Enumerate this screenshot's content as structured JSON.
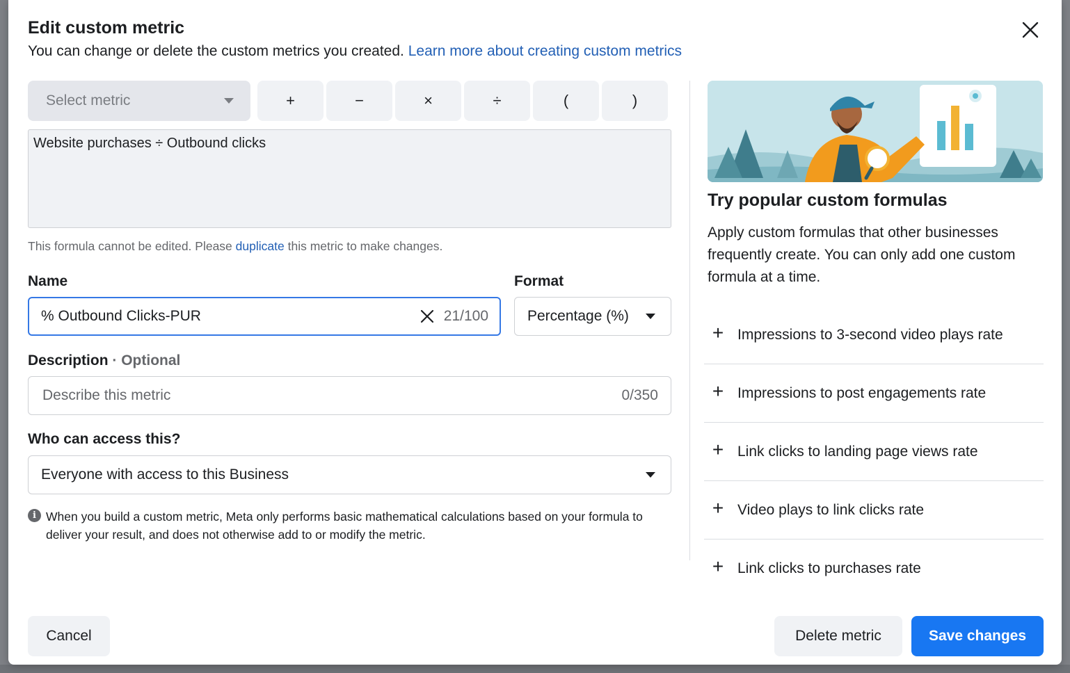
{
  "dialog": {
    "title": "Edit custom metric",
    "subtitle": "You can change or delete the custom metrics you created.",
    "learn_more_link": "Learn more about creating custom metrics"
  },
  "formula_builder": {
    "select_metric_placeholder": "Select metric",
    "operators": [
      "+",
      "−",
      "×",
      "÷",
      "(",
      ")"
    ],
    "formula": "Website purchases ÷ Outbound clicks",
    "note_before": "This formula cannot be edited. Please",
    "note_link": "duplicate",
    "note_after": "this metric to make changes."
  },
  "name_field": {
    "label": "Name",
    "value": "% Outbound Clicks-PUR",
    "count": "21/100"
  },
  "format_field": {
    "label": "Format",
    "value": "Percentage (%)"
  },
  "description_field": {
    "label": "Description",
    "optional": "Optional",
    "placeholder": "Describe this metric",
    "count": "0/350"
  },
  "access_field": {
    "label": "Who can access this?",
    "value": "Everyone with access to this Business"
  },
  "info_note": "When you build a custom metric, Meta only performs basic mathematical calculations based on your formula to deliver your result, and does not otherwise add to or modify the metric.",
  "right_panel": {
    "title": "Try popular custom formulas",
    "description": "Apply custom formulas that other businesses frequently create. You can only add one custom formula at a time.",
    "formulas": [
      "Impressions to 3-second video plays rate",
      "Impressions to post engagements rate",
      "Link clicks to landing page views rate",
      "Video plays to link clicks rate",
      "Link clicks to purchases rate"
    ]
  },
  "footer": {
    "cancel": "Cancel",
    "delete": "Delete metric",
    "save": "Save changes"
  },
  "colors": {
    "primary": "#1877f2",
    "link": "#2360b5",
    "focus_border": "#3578e5"
  },
  "icons": {
    "close": "close-icon",
    "clear": "clear-icon",
    "info": "info-icon",
    "plus": "plus-icon",
    "dropdown": "caret-down-icon"
  }
}
